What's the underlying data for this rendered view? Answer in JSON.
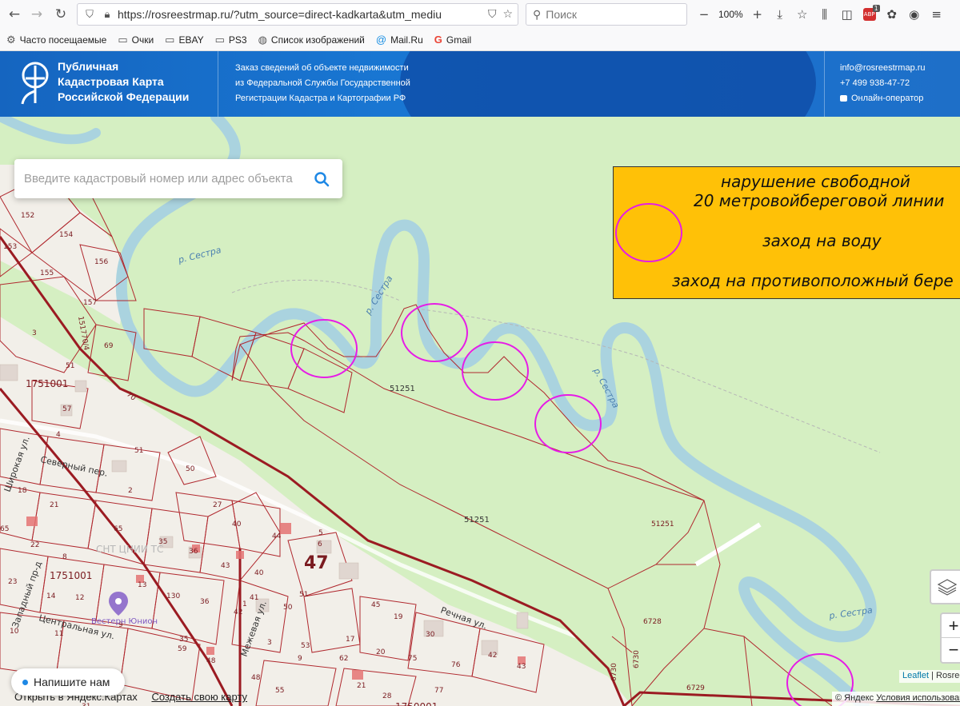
{
  "browser": {
    "url": "https://rosreestrmap.ru/?utm_source=direct-kadkarta&utm_mediu",
    "search_placeholder": "Поиск",
    "zoom": "100%",
    "abp_badge": "1"
  },
  "bookmarks": [
    {
      "label": "Часто посещаемые",
      "icon": "gear-icon"
    },
    {
      "label": "Очки",
      "icon": "folder-icon"
    },
    {
      "label": "EBAY",
      "icon": "folder-icon"
    },
    {
      "label": "PS3",
      "icon": "folder-icon"
    },
    {
      "label": "Список изображений",
      "icon": "globe-icon"
    },
    {
      "label": "Mail.Ru",
      "icon": "mailru-icon"
    },
    {
      "label": "Gmail",
      "icon": "google-icon"
    }
  ],
  "header": {
    "brand_line1": "Публичная",
    "brand_line2": "Кадастровая Карта",
    "brand_line3": "Российской Федерации",
    "desc_line1": "Заказ сведений об объекте недвижимости",
    "desc_line2": "из Федеральной Службы Государственной",
    "desc_line3": "Регистрации Кадастра и Картографии РФ",
    "email": "info@rosreestrmap.ru",
    "phone": "+7 499 938-47-72",
    "operator": "Онлайн-оператор",
    "colors": {
      "primary": "#1976d2",
      "dark": "#0d47a1"
    }
  },
  "map": {
    "search_placeholder": "Введите кадастровый номер или адрес объекта",
    "annotation": {
      "line1": "нарушение свободной",
      "line2": "20 метровойбереговой линии",
      "line3": "заход на воду",
      "line4": "заход на противоположный бере"
    },
    "river_labels": [
      "р. Сестра",
      "р. Сестра",
      "р. Сестра",
      "р. Сестра"
    ],
    "street_labels": {
      "severny": "Северный пер.",
      "shirokaya": "Широкая ул.",
      "zapadny": "Западный пр-д",
      "centralnaya": "Центральная ул.",
      "rechnaya": "Речная ул.",
      "mezhevaya": "Межевая ул."
    },
    "parcels": {
      "p152": "152",
      "p153": "153",
      "p154": "154",
      "p155": "155",
      "p156": "156",
      "p157": "157",
      "p3": "3",
      "p69": "69",
      "p51a": "51",
      "p70": "70",
      "p151770": "151770/4",
      "q1751001a": "1751001",
      "q1751001b": "1751001",
      "q1750001": "1750001",
      "p57": "57",
      "p4": "4",
      "p51b": "51",
      "p50": "50",
      "p2": "2",
      "p18": "18",
      "p21": "21",
      "p65a": "65",
      "p65b": "65",
      "p22": "22",
      "p8": "8",
      "p27": "27",
      "p40a": "40",
      "p44": "44",
      "p35": "35",
      "p36": "36",
      "p5": "5",
      "p6": "6",
      "p23": "23",
      "p14": "14",
      "p12": "12",
      "p13": "13",
      "p130": "130",
      "p43a": "43",
      "p40b": "40",
      "p36b": "36",
      "p41": "41",
      "p42a": "42",
      "p1": "1",
      "p51c": "51",
      "p50b": "50",
      "p45": "45",
      "p19": "19",
      "p10": "10",
      "p11": "11",
      "p9": "9",
      "p59": "59",
      "p35b": "35",
      "p48a": "48",
      "p3b": "3",
      "p53": "53",
      "p17": "17",
      "p62": "62",
      "p9b": "9",
      "p20": "20",
      "p75": "75",
      "p30": "30",
      "p76": "76",
      "p42b": "42",
      "p43b": "43",
      "p48b": "48",
      "p55": "55",
      "p21b": "21",
      "p28": "28",
      "p77": "77",
      "p31": "31",
      "big47": "47",
      "z51251a": "51251",
      "z51251b": "51251",
      "z51251c": "51251",
      "z6728": "6728",
      "z6730a": "6730",
      "z6730b": "6730",
      "z6729": "6729"
    },
    "snt_label": "СНТ ЦНИИ ТС",
    "poi_label": "Вестерн Юнион",
    "attribution": {
      "leaflet": "Leaflet",
      "sep": " | ",
      "rosreestr": "Rosree"
    },
    "copyright": {
      "prefix": "© Яндекс ",
      "terms": "Условия использован"
    },
    "zoom_in": "+",
    "zoom_out": "−"
  },
  "bottom": {
    "write_us": "Напишите нам",
    "open_yandex": "Открыть в Яндекс.Картах",
    "create_map": "Создать свою карту"
  }
}
